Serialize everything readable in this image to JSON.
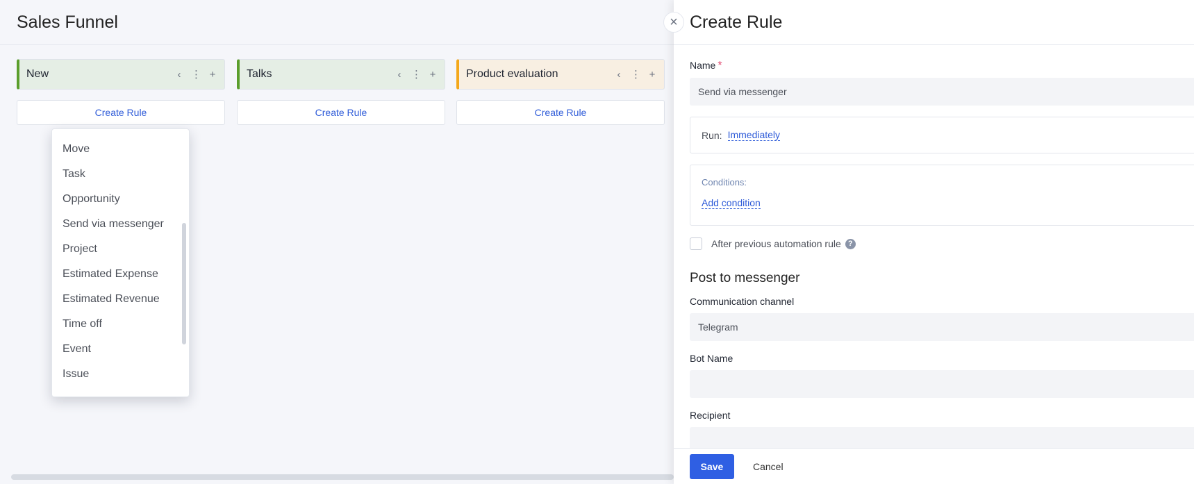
{
  "board": {
    "title": "Sales Funnel",
    "columns": [
      {
        "name": "New",
        "accent": "#5b9e2c",
        "bg": "#e5eee5",
        "rule_label": "Create Rule"
      },
      {
        "name": "Talks",
        "accent": "#5b9e2c",
        "bg": "#e5eee5",
        "rule_label": "Create Rule"
      },
      {
        "name": "Product evaluation",
        "accent": "#f4a81b",
        "bg": "#f8efe2",
        "rule_label": "Create Rule"
      }
    ],
    "column_icons": [
      "chevron-left-icon",
      "more-vertical-icon",
      "plus-icon"
    ]
  },
  "dropdown": {
    "items": [
      "Move",
      "Task",
      "Opportunity",
      "Send via messenger",
      "Project",
      "Estimated Expense",
      "Estimated Revenue",
      "Time off",
      "Event",
      "Issue"
    ]
  },
  "panel": {
    "title": "Create Rule",
    "name_label": "Name",
    "name_required": "*",
    "name_value": "Send via messenger",
    "run_label": "Run:",
    "run_value": "Immediately",
    "conditions_label": "Conditions:",
    "add_condition": "Add condition",
    "after_previous": "After previous automation rule",
    "help_glyph": "?",
    "section_title": "Post to messenger",
    "channel_label": "Communication channel",
    "channel_value": "Telegram",
    "bot_label": "Bot Name",
    "bot_value": "",
    "recipient_label": "Recipient",
    "save": "Save",
    "cancel": "Cancel"
  },
  "colors": {
    "primary": "#2f5fe3",
    "link": "#2e5bd8",
    "required": "#e0436b"
  }
}
